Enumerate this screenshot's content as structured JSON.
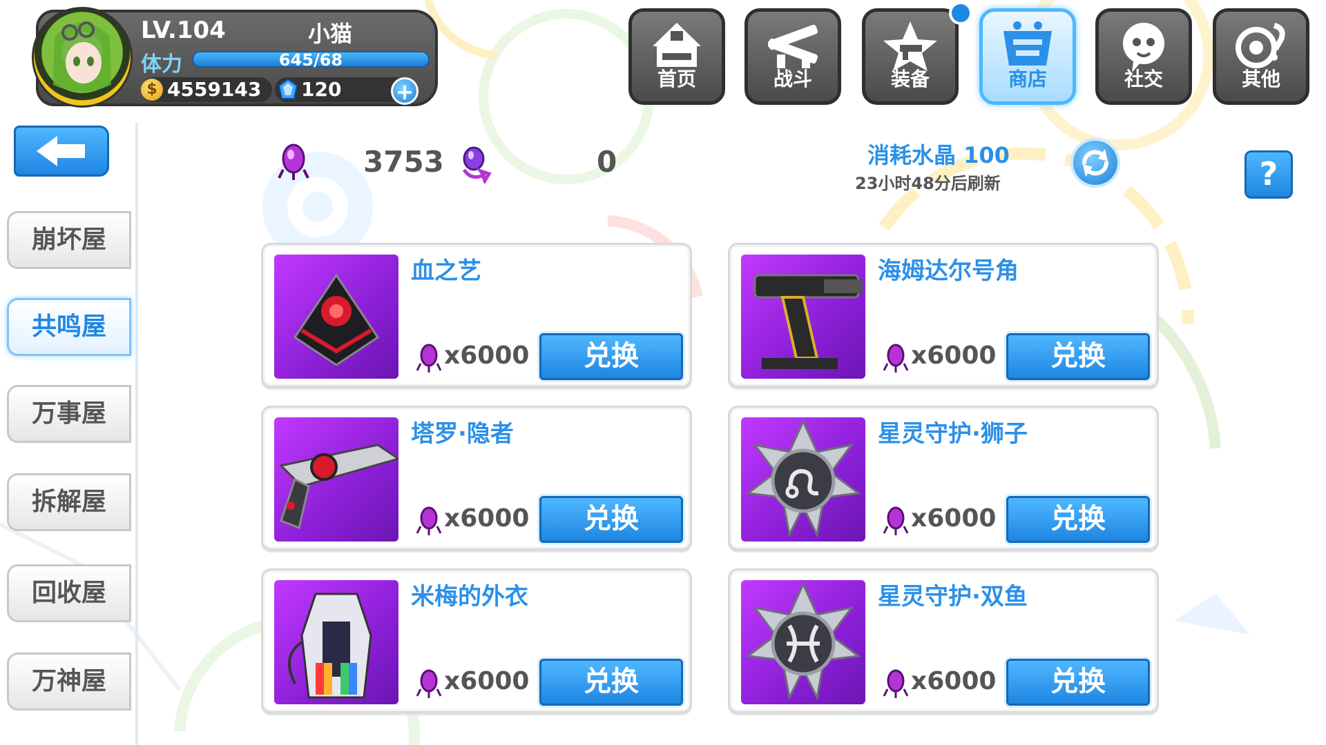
{
  "player": {
    "level": "LV.104",
    "name": "小猫",
    "stamina_label": "体力",
    "stamina_value": "645/68",
    "stamina_fill": 1.0,
    "gold": "4559143",
    "gems": "120"
  },
  "nav": {
    "tabs": [
      {
        "label": "首页",
        "icon": "house-icon",
        "active": false
      },
      {
        "label": "战斗",
        "icon": "crossed-guns-icon",
        "active": false
      },
      {
        "label": "装备",
        "icon": "star-gun-icon",
        "active": false
      },
      {
        "label": "商店",
        "icon": "shop-basket-icon",
        "active": true
      },
      {
        "label": "社交",
        "icon": "chat-face-icon",
        "active": false
      },
      {
        "label": "其他",
        "icon": "misc-swirl-icon",
        "active": false
      }
    ]
  },
  "sidebar": {
    "items": [
      {
        "label": "崩坏屋",
        "active": false
      },
      {
        "label": "共鸣屋",
        "active": true
      },
      {
        "label": "万事屋",
        "active": false
      },
      {
        "label": "拆解屋",
        "active": false
      },
      {
        "label": "回收屋",
        "active": false
      },
      {
        "label": "万神屋",
        "active": false
      }
    ]
  },
  "shop": {
    "crystal_count": "3753",
    "swap_crystal_count": "0",
    "consume_text": "消耗水晶 100",
    "refresh_text": "23小时48分后刷新",
    "help_label": "?"
  },
  "items": [
    {
      "name": "血之艺",
      "price": "x6000",
      "button": "兑换",
      "thumb": "blood-art-emblem-icon"
    },
    {
      "name": "海姆达尔号角",
      "price": "x6000",
      "button": "兑换",
      "thumb": "heimdall-horn-cannon-icon"
    },
    {
      "name": "塔罗·隐者",
      "price": "x6000",
      "button": "兑换",
      "thumb": "tarot-hermit-gun-icon"
    },
    {
      "name": "星灵守护·狮子",
      "price": "x6000",
      "button": "兑换",
      "thumb": "leo-zodiac-badge-icon"
    },
    {
      "name": "米梅的外衣",
      "price": "x6000",
      "button": "兑换",
      "thumb": "mime-coat-costume-icon"
    },
    {
      "name": "星灵守护·双鱼",
      "price": "x6000",
      "button": "兑换",
      "thumb": "pisces-zodiac-badge-icon"
    }
  ],
  "colors": {
    "accent_blue": "#1f86e2",
    "title_blue": "#2b90e8",
    "item_bg_purple": "#a62ae6"
  }
}
